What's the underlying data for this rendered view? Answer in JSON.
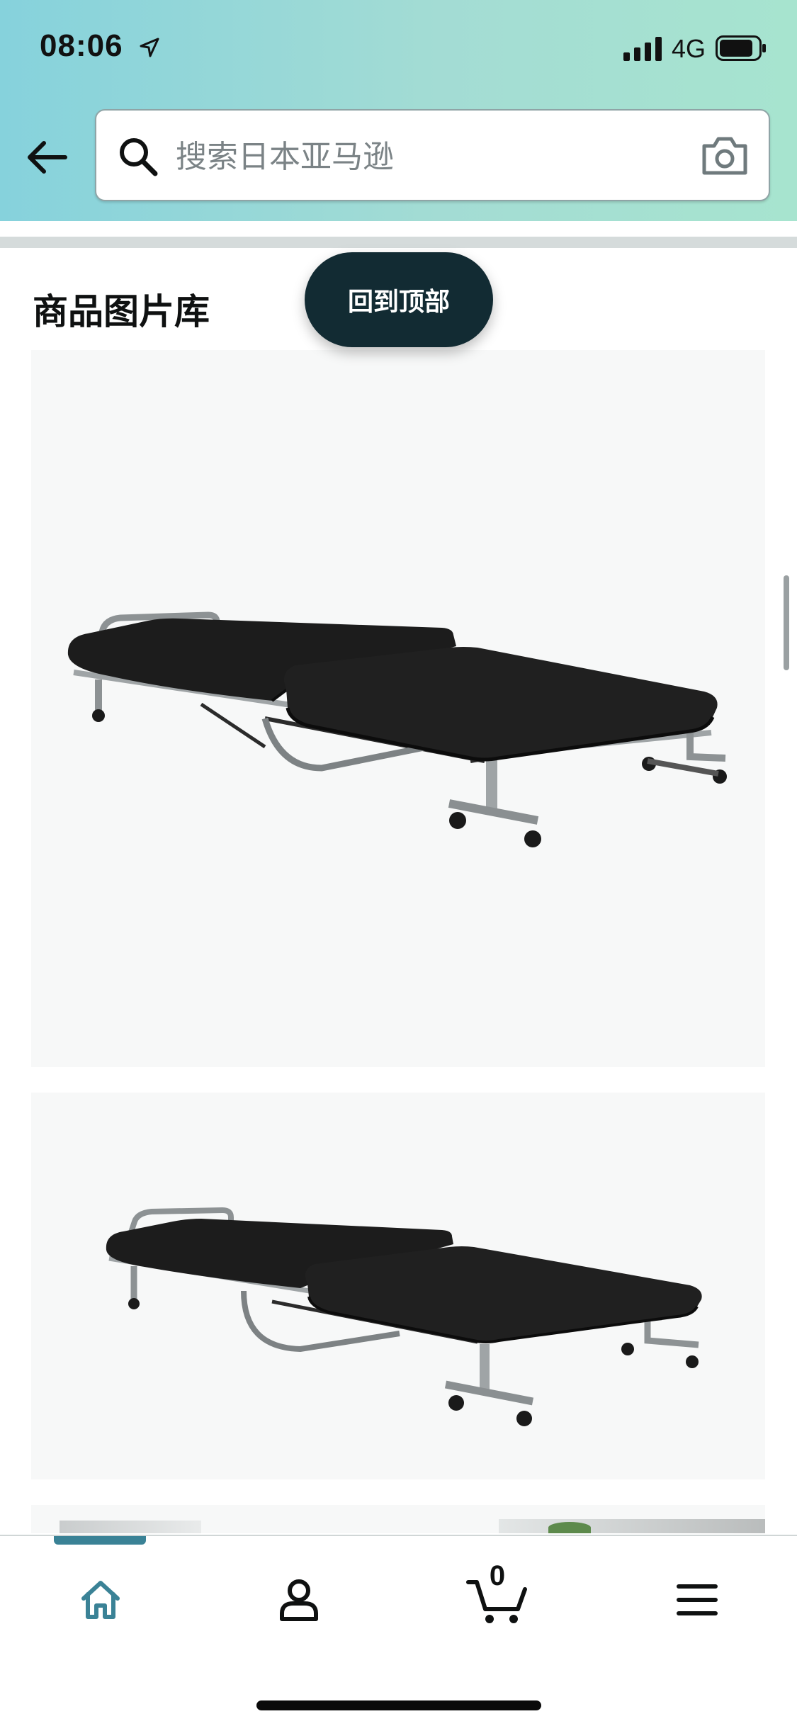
{
  "status_bar": {
    "time": "08:06",
    "network": "4G"
  },
  "search": {
    "placeholder": "搜索日本亚马逊"
  },
  "icons": {
    "back": "arrow-left-icon",
    "search": "search-icon",
    "camera": "camera-icon",
    "home": "home-icon",
    "account": "person-icon",
    "cart": "cart-icon",
    "menu": "hamburger-menu-icon"
  },
  "gallery": {
    "title": "商品图片库",
    "back_to_top_label": "回到顶部",
    "images": [
      {
        "name": "folding-bed-image-1"
      },
      {
        "name": "folding-bed-image-2"
      },
      {
        "name": "folding-bed-image-3"
      }
    ]
  },
  "tab_bar": {
    "active_tab": "home",
    "cart_count": "0"
  },
  "colors": {
    "header_gradient_start": "#86d2dc",
    "header_gradient_end": "#a7e4cf",
    "back_to_top_bg": "#122b33",
    "active_tab": "#3a8296",
    "image_bg": "#f7f8f8"
  }
}
